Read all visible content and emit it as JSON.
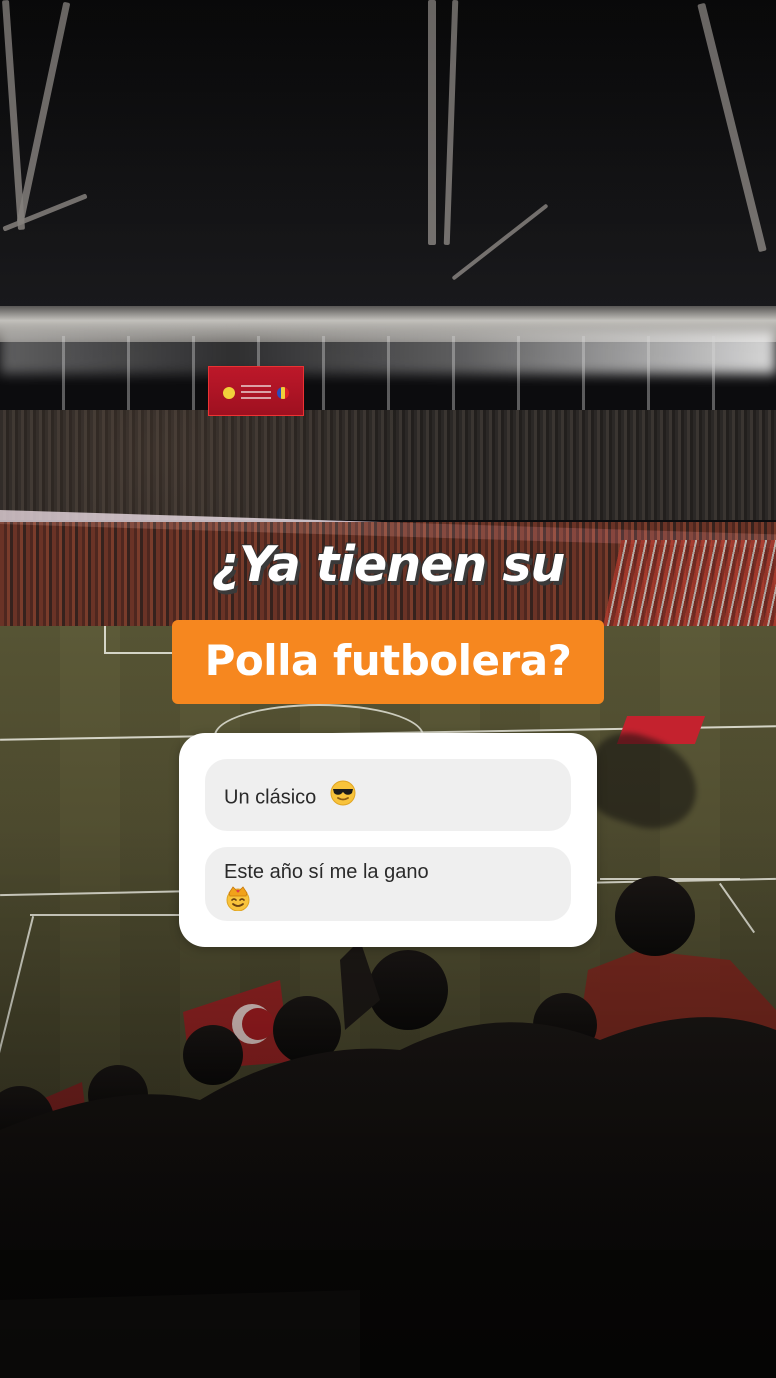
{
  "story": {
    "headline": "¿Ya tienen su",
    "highlight": "Polla futbolera?",
    "quiz": {
      "options": [
        {
          "text": "Un clásico",
          "emoji": "sunglasses-face-emoji"
        },
        {
          "text": "Este año sí me la gano",
          "emoji": "crowned-face-emoji"
        }
      ]
    }
  },
  "colors": {
    "highlight_bg": "#f6871f",
    "card_bg": "#ffffff",
    "option_bg": "#efefef",
    "headline_text": "#ffffff"
  }
}
